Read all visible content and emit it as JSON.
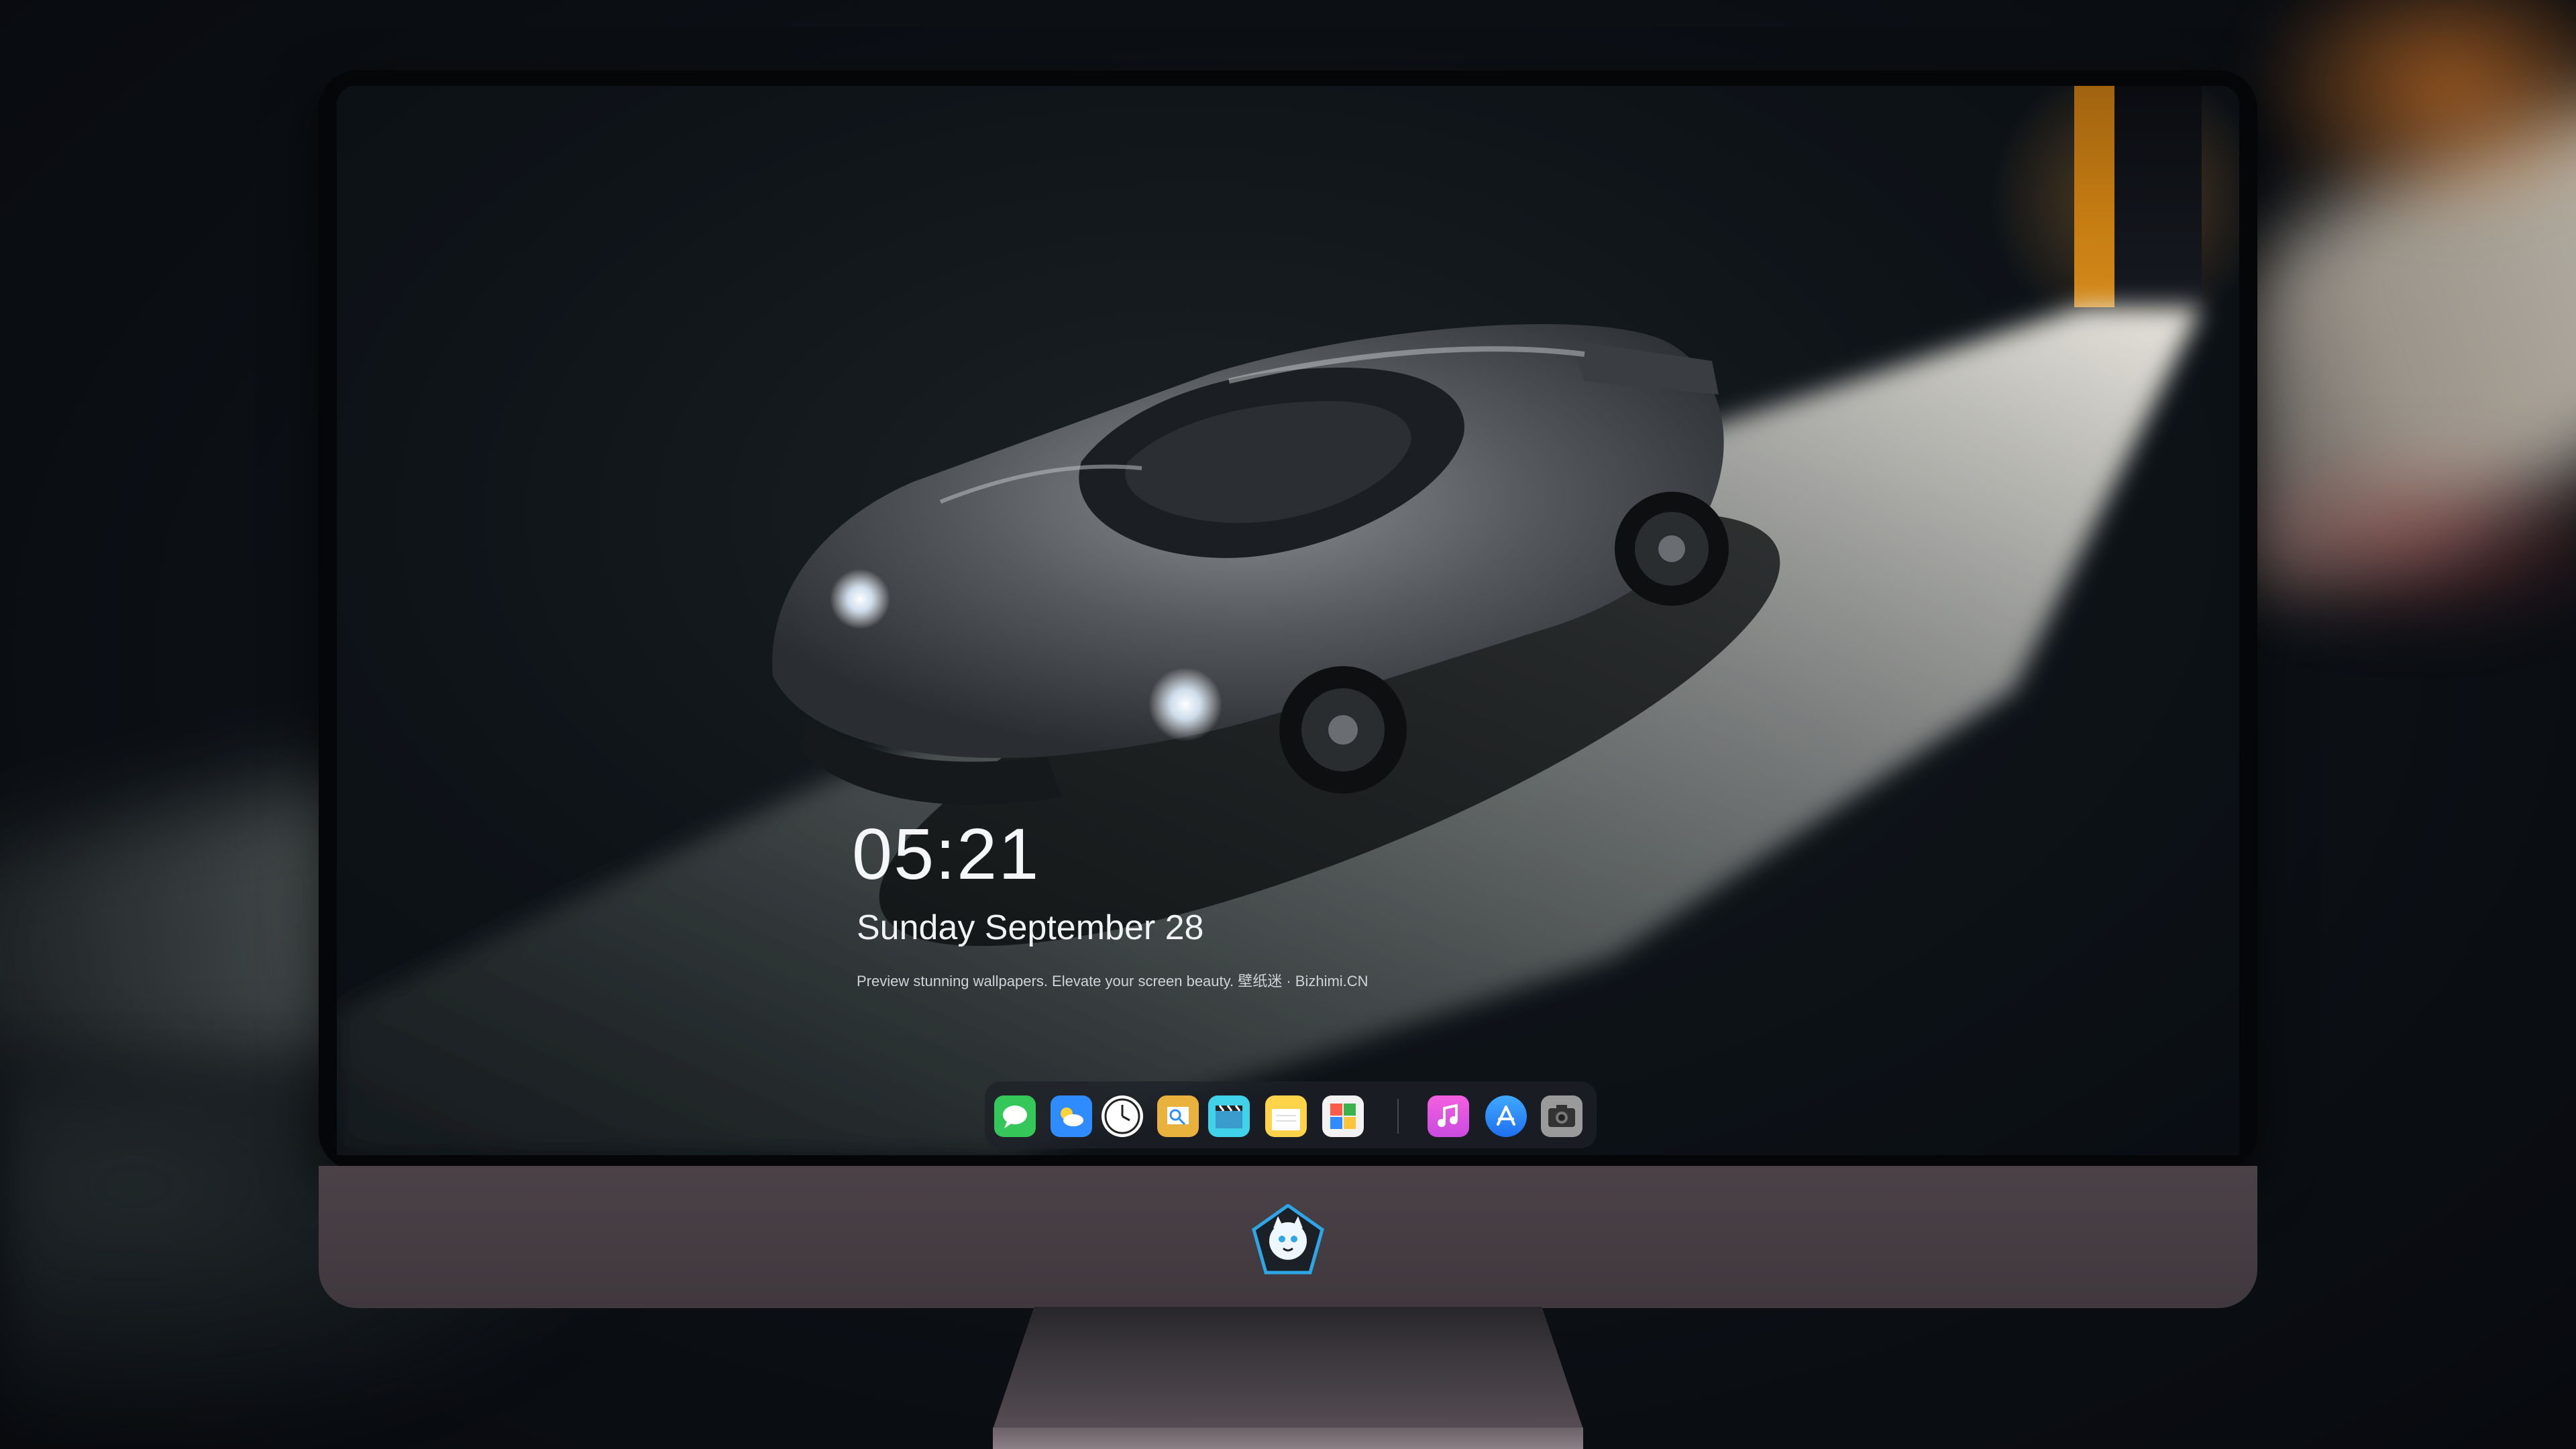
{
  "lock_screen": {
    "time": "05:21",
    "date": "Sunday September  28",
    "tagline": "Preview stunning wallpapers. Elevate your screen beauty. 壁纸迷 · Bizhimi.CN"
  },
  "dock": {
    "apps": [
      {
        "icon": "messages-icon",
        "color": "#35c759"
      },
      {
        "icon": "weather-icon",
        "color": "#2f8cff"
      },
      {
        "icon": "clock-icon",
        "color": "#ffffff"
      },
      {
        "icon": "preview-icon",
        "color": "#e9b23d"
      },
      {
        "icon": "video-clip-icon",
        "color": "#3fd2e8"
      },
      {
        "icon": "notes-icon",
        "color": "#ffd44a"
      },
      {
        "icon": "photo-booth-icon",
        "color": "#f2f2f2"
      },
      {
        "icon": "itunes-icon",
        "color": "#e64ed8"
      },
      {
        "icon": "app-store-icon",
        "color": "#1f8cff"
      },
      {
        "icon": "camera-icon",
        "color": "#cfcfcf"
      }
    ]
  },
  "brand_logo": {
    "icon": "cat-mascot-logo-icon",
    "colors": [
      "#2ea6e6",
      "#eef6ff"
    ]
  }
}
